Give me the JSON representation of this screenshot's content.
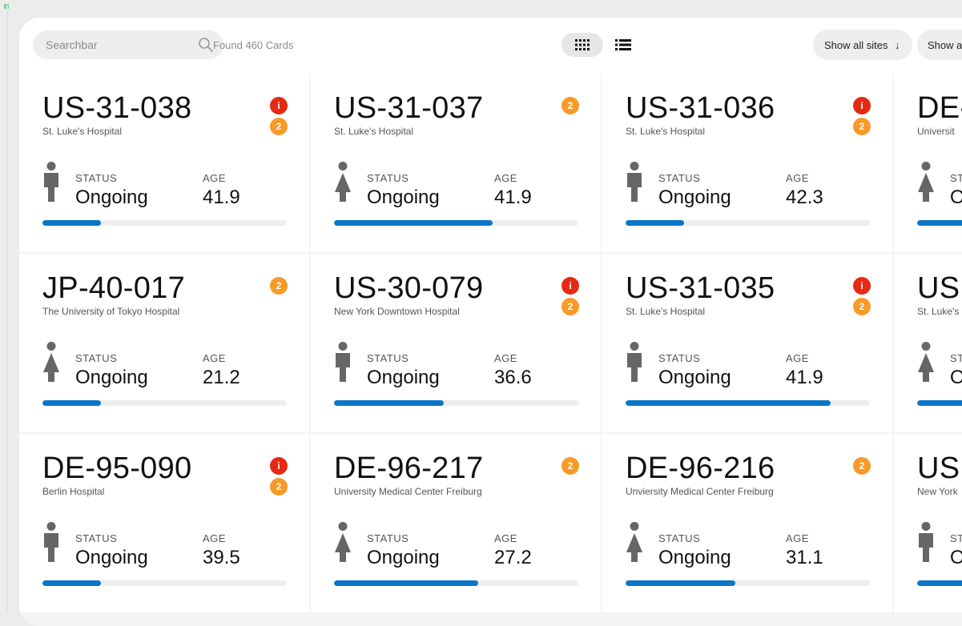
{
  "toolbar": {
    "search_placeholder": "Searchbar",
    "found_text": "Found 460 Cards",
    "sites_label": "Show all sites",
    "sites_arrow": "↓",
    "other_label": "Show a"
  },
  "colors": {
    "alert_badge": "#e52a12",
    "count_badge": "#f79a27",
    "progress_fill": "#0b76c8"
  },
  "labels": {
    "status": "STATUS",
    "age": "AGE"
  },
  "cards": [
    {
      "id": "US-31-038",
      "site": "St. Luke's Hospital",
      "alert": "i",
      "count": "2",
      "person": "male",
      "status": "Ongoing",
      "age": "41.9",
      "progress": 0.24
    },
    {
      "id": "US-31-037",
      "site": "St. Luke's Hospital",
      "alert": "",
      "count": "2",
      "person": "female",
      "status": "Ongoing",
      "age": "41.9",
      "progress": 0.65
    },
    {
      "id": "US-31-036",
      "site": "St. Luke's Hospital",
      "alert": "i",
      "count": "2",
      "person": "male",
      "status": "Ongoing",
      "age": "42.3",
      "progress": 0.24
    },
    {
      "id": "DE-",
      "site": "Universit",
      "alert": "",
      "count": "",
      "person": "female",
      "status": "O",
      "age": "",
      "progress": 0.5
    },
    {
      "id": "JP-40-017",
      "site": "The University of Tokyo Hospital",
      "alert": "",
      "count": "2",
      "person": "female",
      "status": "Ongoing",
      "age": "21.2",
      "progress": 0.24
    },
    {
      "id": "US-30-079",
      "site": "New York Downtown Hospital",
      "alert": "i",
      "count": "2",
      "person": "male",
      "status": "Ongoing",
      "age": "36.6",
      "progress": 0.45
    },
    {
      "id": "US-31-035",
      "site": "St. Luke's Hospital",
      "alert": "i",
      "count": "2",
      "person": "male",
      "status": "Ongoing",
      "age": "41.9",
      "progress": 0.84
    },
    {
      "id": "US",
      "site": "St. Luke's",
      "alert": "",
      "count": "",
      "person": "female",
      "status": "O",
      "age": "",
      "progress": 0.5
    },
    {
      "id": "DE-95-090",
      "site": "Berlin Hospital",
      "alert": "i",
      "count": "2",
      "person": "male",
      "status": "Ongoing",
      "age": "39.5",
      "progress": 0.24
    },
    {
      "id": "DE-96-217",
      "site": "University Medical Center Freiburg",
      "alert": "",
      "count": "2",
      "person": "female",
      "status": "Ongoing",
      "age": "27.2",
      "progress": 0.59
    },
    {
      "id": "DE-96-216",
      "site": "Unviersity Medical Center Freiburg",
      "alert": "",
      "count": "2",
      "person": "female",
      "status": "Ongoing",
      "age": "31.1",
      "progress": 0.45
    },
    {
      "id": "US",
      "site": "New York",
      "alert": "",
      "count": "",
      "person": "male",
      "status": "O",
      "age": "",
      "progress": 0.5
    }
  ]
}
